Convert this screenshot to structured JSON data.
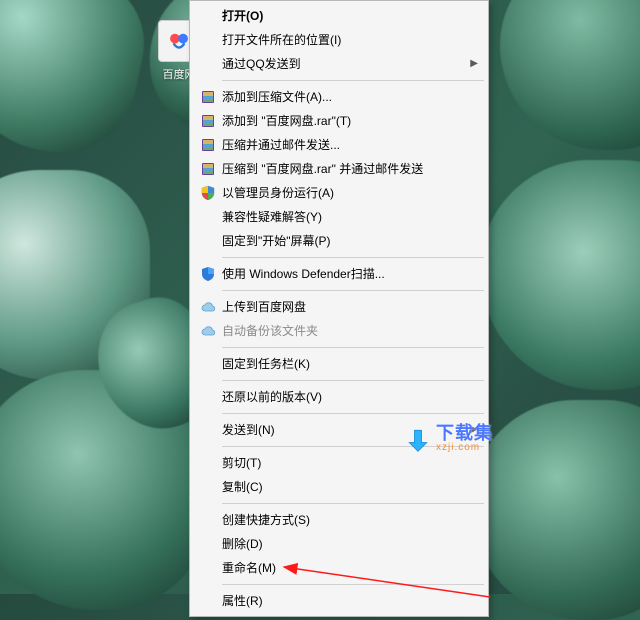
{
  "desktop": {
    "icon_label": "百度网",
    "icon_name": "baidu-netdisk-icon"
  },
  "menu": {
    "items": [
      {
        "id": "open",
        "label": "打开(O)",
        "icon": null,
        "bold": true,
        "submenu": false
      },
      {
        "id": "open-location",
        "label": "打开文件所在的位置(I)",
        "icon": null,
        "submenu": false
      },
      {
        "id": "send-qq",
        "label": "通过QQ发送到",
        "icon": null,
        "submenu": true
      },
      {
        "sep": true
      },
      {
        "id": "rar-add",
        "label": "添加到压缩文件(A)...",
        "icon": "rar",
        "submenu": false
      },
      {
        "id": "rar-add-named",
        "label": "添加到 \"百度网盘.rar\"(T)",
        "icon": "rar",
        "submenu": false
      },
      {
        "id": "rar-mail",
        "label": "压缩并通过邮件发送...",
        "icon": "rar",
        "submenu": false
      },
      {
        "id": "rar-mail-named",
        "label": "压缩到 \"百度网盘.rar\" 并通过邮件发送",
        "icon": "rar",
        "submenu": false
      },
      {
        "id": "run-admin",
        "label": "以管理员身份运行(A)",
        "icon": "shield",
        "submenu": false
      },
      {
        "id": "compat",
        "label": "兼容性疑难解答(Y)",
        "icon": null,
        "submenu": false
      },
      {
        "id": "pin-start",
        "label": "固定到\"开始\"屏幕(P)",
        "icon": null,
        "submenu": false
      },
      {
        "sep": true
      },
      {
        "id": "defender",
        "label": "使用 Windows Defender扫描...",
        "icon": "defender",
        "submenu": false
      },
      {
        "sep": true
      },
      {
        "id": "upload-baidu",
        "label": "上传到百度网盘",
        "icon": "cloud",
        "submenu": false
      },
      {
        "id": "auto-backup",
        "label": "自动备份该文件夹",
        "icon": "cloud",
        "submenu": false,
        "disabled": true
      },
      {
        "sep": true
      },
      {
        "id": "pin-taskbar",
        "label": "固定到任务栏(K)",
        "icon": null,
        "submenu": false
      },
      {
        "sep": true
      },
      {
        "id": "restore",
        "label": "还原以前的版本(V)",
        "icon": null,
        "submenu": false
      },
      {
        "sep": true
      },
      {
        "id": "send-to",
        "label": "发送到(N)",
        "icon": null,
        "submenu": true
      },
      {
        "sep": true
      },
      {
        "id": "cut",
        "label": "剪切(T)",
        "icon": null,
        "submenu": false
      },
      {
        "id": "copy",
        "label": "复制(C)",
        "icon": null,
        "submenu": false
      },
      {
        "sep": true
      },
      {
        "id": "shortcut",
        "label": "创建快捷方式(S)",
        "icon": null,
        "submenu": false
      },
      {
        "id": "delete",
        "label": "删除(D)",
        "icon": null,
        "submenu": false
      },
      {
        "id": "rename",
        "label": "重命名(M)",
        "icon": null,
        "submenu": false
      },
      {
        "sep": true
      },
      {
        "id": "properties",
        "label": "属性(R)",
        "icon": null,
        "submenu": false
      }
    ]
  },
  "watermark": {
    "title": "下载集",
    "url": "xzji.com"
  }
}
